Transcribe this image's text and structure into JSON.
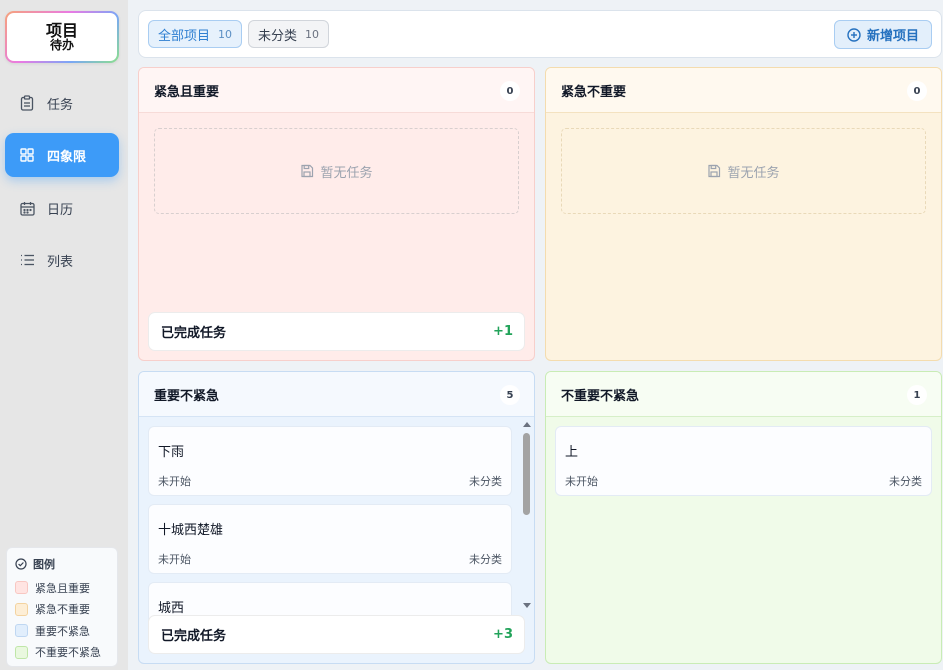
{
  "logo": {
    "line1": "项目",
    "line2": "待办"
  },
  "nav": [
    {
      "label": "任务",
      "icon": "clipboard-icon",
      "active": false
    },
    {
      "label": "四象限",
      "icon": "grid-icon",
      "active": true
    },
    {
      "label": "日历",
      "icon": "calendar-icon",
      "active": false
    },
    {
      "label": "列表",
      "icon": "list-icon",
      "active": false
    }
  ],
  "legend": {
    "title": "图例",
    "items": [
      {
        "label": "紧急且重要",
        "color": "#ffe4e2",
        "border": "#f8c7c2"
      },
      {
        "label": "紧急不重要",
        "color": "#fdeed6",
        "border": "#f3d3a0"
      },
      {
        "label": "重要不紧急",
        "color": "#e1eefc",
        "border": "#bfd7f2"
      },
      {
        "label": "不重要不紧急",
        "color": "#e9f8df",
        "border": "#bfe6a8"
      }
    ]
  },
  "topbar": {
    "filters": [
      {
        "label": "全部项目",
        "count": "10",
        "active": true
      },
      {
        "label": "未分类",
        "count": "10",
        "active": false
      }
    ],
    "new_label": "新增项目"
  },
  "quadrants": {
    "q1": {
      "title": "紧急且重要",
      "count": "0",
      "empty": "暂无任务",
      "done_label": "已完成任务",
      "done_count": "+1"
    },
    "q2": {
      "title": "紧急不重要",
      "count": "0",
      "empty": "暂无任务"
    },
    "q3": {
      "title": "重要不紧急",
      "count": "5",
      "done_label": "已完成任务",
      "done_count": "+3",
      "tasks": [
        {
          "title": "下雨",
          "status": "未开始",
          "category": "未分类"
        },
        {
          "title": "十城西楚雄",
          "status": "未开始",
          "category": "未分类"
        },
        {
          "title": "城西",
          "status": "",
          "category": ""
        }
      ]
    },
    "q4": {
      "title": "不重要不紧急",
      "count": "1",
      "tasks": [
        {
          "title": "上",
          "status": "未开始",
          "category": "未分类"
        }
      ]
    }
  }
}
